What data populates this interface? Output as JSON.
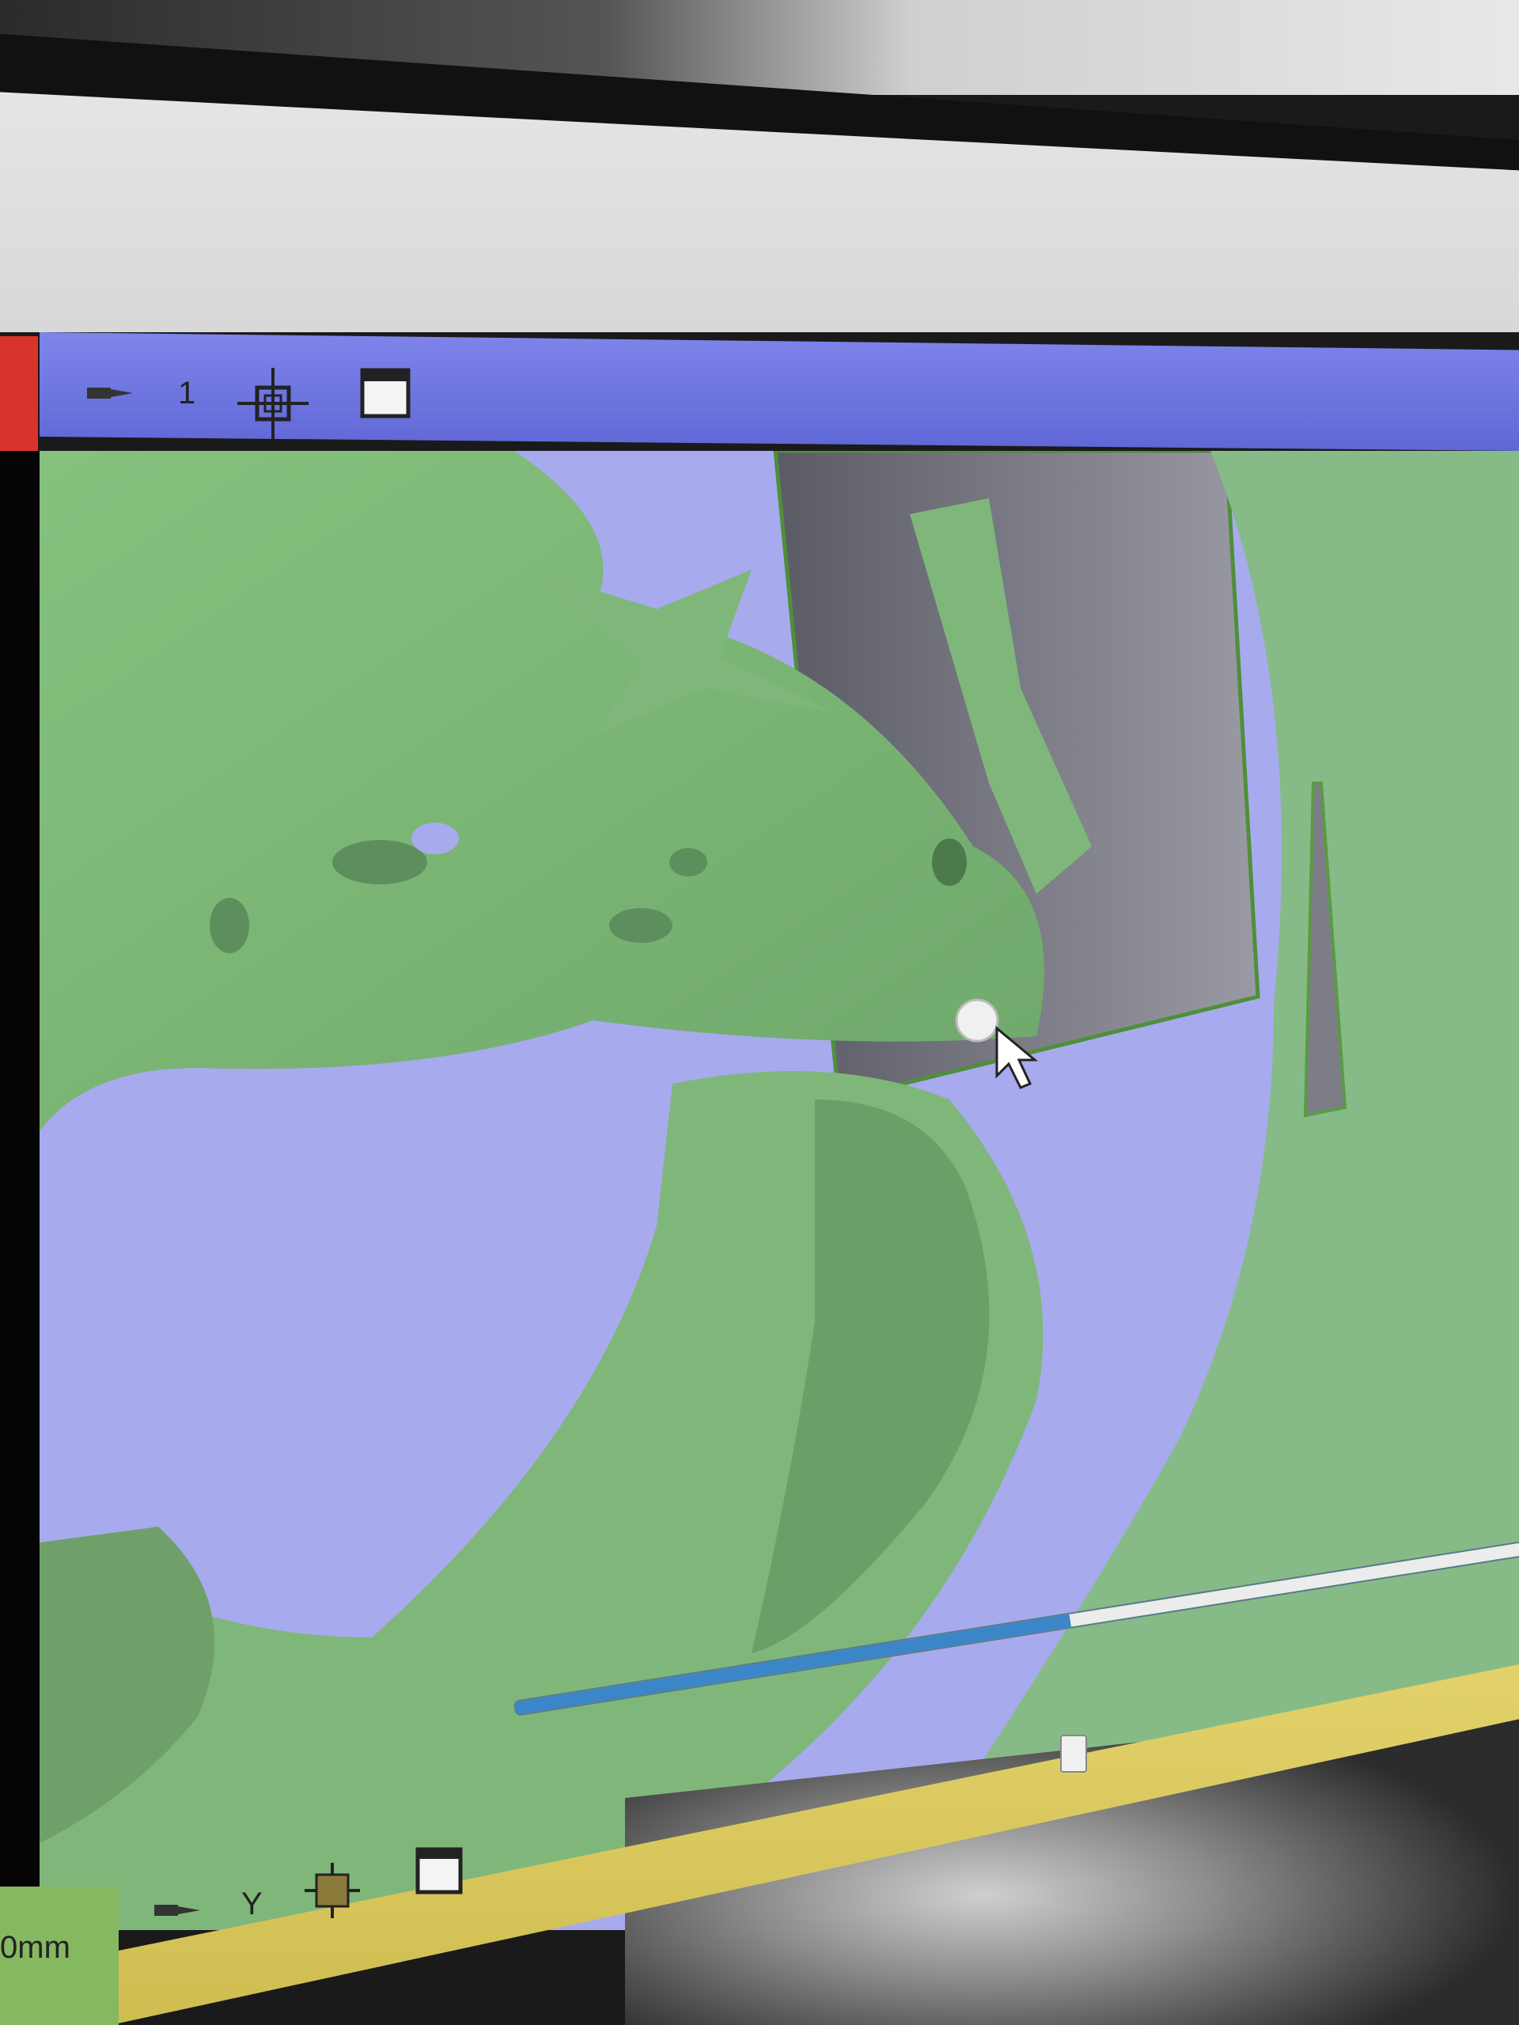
{
  "viewer_top": {
    "layer_number": "1",
    "icons": [
      "pin-icon",
      "crosshair-center-icon",
      "window-maximize-icon"
    ]
  },
  "viewer_bottom": {
    "axis_label": "Y",
    "unit_label": "0mm",
    "icons": [
      "pin-icon",
      "crosshair-slice-icon",
      "window-maximize-icon"
    ],
    "slider_position_fraction": 0.55
  },
  "colors": {
    "title_bar": "#6b72e0",
    "bone_surface": "#7fb87a",
    "background": "#a8aaee",
    "yellow_bar": "#d8c75c",
    "slice_plane": "#8a8a92"
  }
}
